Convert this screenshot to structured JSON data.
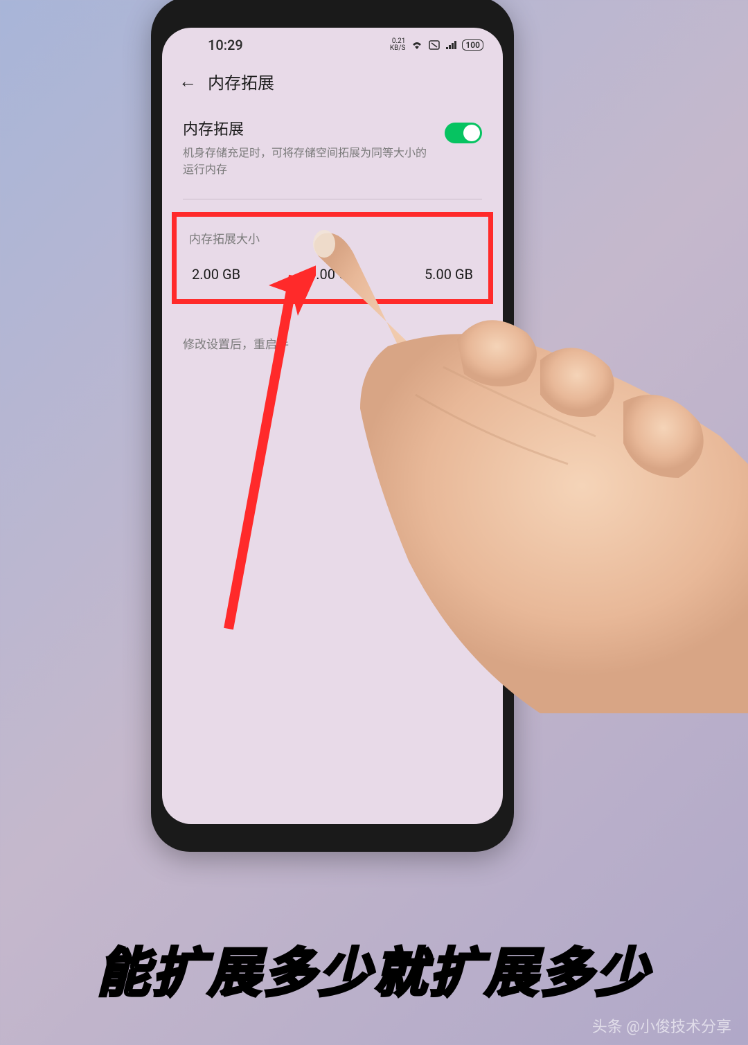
{
  "status_bar": {
    "time": "10:29",
    "speed_value": "0.21",
    "speed_unit": "KB/S",
    "battery": "100"
  },
  "header": {
    "title": "内存拓展"
  },
  "setting": {
    "title": "内存拓展",
    "description": "机身存储充足时，可将存储空间拓展为同等大小的运行内存",
    "toggle_on": true
  },
  "size_section": {
    "label": "内存拓展大小",
    "options": [
      "2.00 GB",
      "3.00 GB",
      "5.00 GB"
    ]
  },
  "hint": "修改设置后，重启手",
  "caption": "能扩展多少就扩展多少",
  "watermark": "头条 @小俊技术分享"
}
